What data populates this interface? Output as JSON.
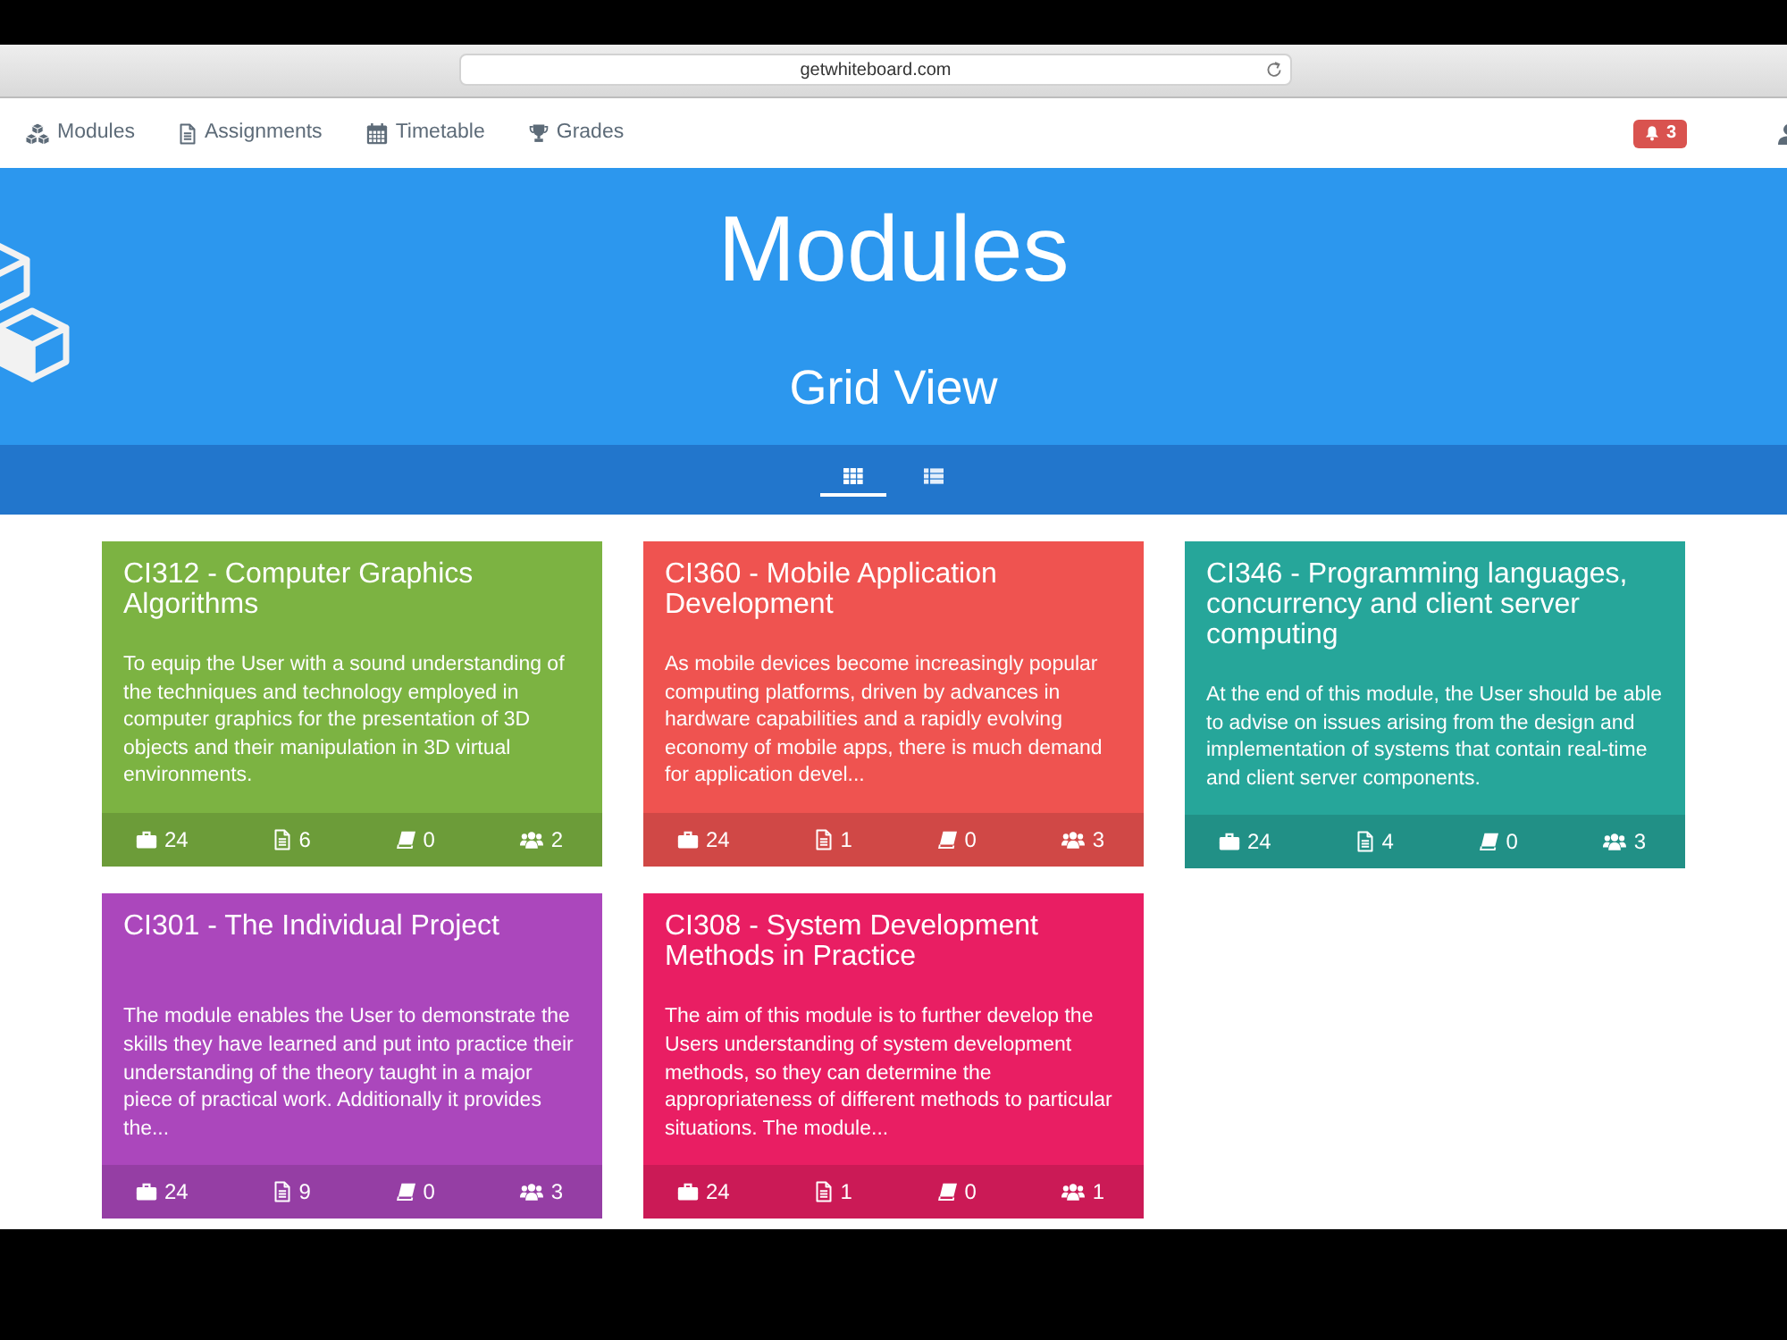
{
  "browser": {
    "url": "getwhiteboard.com"
  },
  "navbar": {
    "items": [
      {
        "label": "Modules"
      },
      {
        "label": "Assignments"
      },
      {
        "label": "Timetable"
      },
      {
        "label": "Grades"
      }
    ],
    "notifications": "3"
  },
  "header": {
    "title": "Modules",
    "subtitle": "Grid View"
  },
  "view_toggle": [
    {
      "selected": true
    },
    {
      "selected": false
    }
  ],
  "modules": [
    {
      "title": "CI312 - Computer Graphics Algorithms",
      "description": "To equip the User with a sound understanding of the techniques and technology employed in computer graphics for the presentation of 3D objects and their manipulation in 3D virtual environments.",
      "color": "#7cb342",
      "stats": [
        "24",
        "6",
        "0",
        "2"
      ]
    },
    {
      "title": "CI360 - Mobile Application Development",
      "description": "As mobile devices become increasingly popular computing platforms, driven by advances in hardware capabilities and a rapidly evolving economy of mobile apps, there is much demand for application devel...",
      "color": "#ef5350",
      "stats": [
        "24",
        "1",
        "0",
        "3"
      ]
    },
    {
      "title": "CI346 - Programming languages, concurrency and client server computing",
      "description": "At the end of this module, the User should be able to advise on issues arising from the design and implementation of systems that contain real-time and client server components.",
      "color": "#26a69a",
      "stats": [
        "24",
        "4",
        "0",
        "3"
      ]
    },
    {
      "title": "CI301 - The Individual Project",
      "description": "The module enables the User to demonstrate the skills they have learned and put into practice their understanding of the theory taught in a major piece of practical work. Additionally it provides the...",
      "color": "#ab47bc",
      "stats": [
        "24",
        "9",
        "0",
        "3"
      ]
    },
    {
      "title": "CI308 - System Development Methods in Practice",
      "description": "The aim of this module is to further develop the Users understanding of system development methods, so they can determine the appropriateness of different methods to particular situations. The module...",
      "color": "#e91e63",
      "stats": [
        "24",
        "1",
        "0",
        "1"
      ]
    }
  ]
}
